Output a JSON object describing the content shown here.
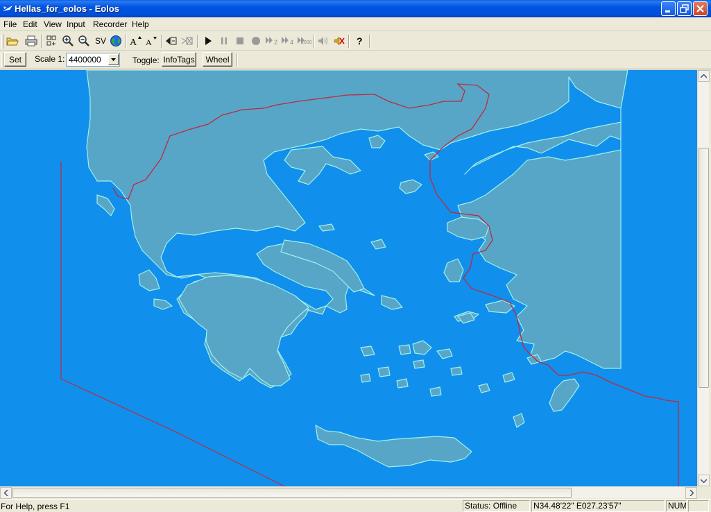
{
  "window": {
    "title": "Hellas_for_eolos - Eolos",
    "app_icon": "eolos-app-icon",
    "controls": [
      "minimize-icon",
      "maximize-icon",
      "close-icon"
    ]
  },
  "menu": {
    "items": [
      "File",
      "Edit",
      "View",
      "Input",
      "Recorder",
      "Help"
    ]
  },
  "toolbar": {
    "icons": [
      "open-folder-icon",
      "print-icon",
      "zoom-fit-icon",
      "zoom-in-icon",
      "zoom-out-icon",
      "sv-icon",
      "globe-icon",
      "font-increase-icon",
      "font-decrease-icon",
      "track-back-icon",
      "track-forward-icon",
      "play-icon",
      "pause-icon",
      "stop-icon",
      "record-icon",
      "speed-x2-icon",
      "speed-x4-icon",
      "speed-x1000-icon",
      "sound-icon",
      "mute-icon",
      "help-icon"
    ],
    "sv_label": "SV",
    "x2_label": "2",
    "x4_label": "4",
    "x1000_label": "1000"
  },
  "controls": {
    "set_label": "Set",
    "scale_label": "Scale 1:",
    "scale_value": "4400000",
    "toggle_label": "Toggle:",
    "infotags_label": "InfoTags",
    "wheel_label": "Wheel"
  },
  "map": {
    "sea_color": "#118fec",
    "land_color": "#57a6c8",
    "coast_color": "#9cf2f0",
    "border_color": "#c0283c"
  },
  "status": {
    "help_text": "For Help, press F1",
    "connection": "Status: Offline",
    "coordinates": "N34.48'22\" E027.23'57\"",
    "num": "NUM"
  }
}
